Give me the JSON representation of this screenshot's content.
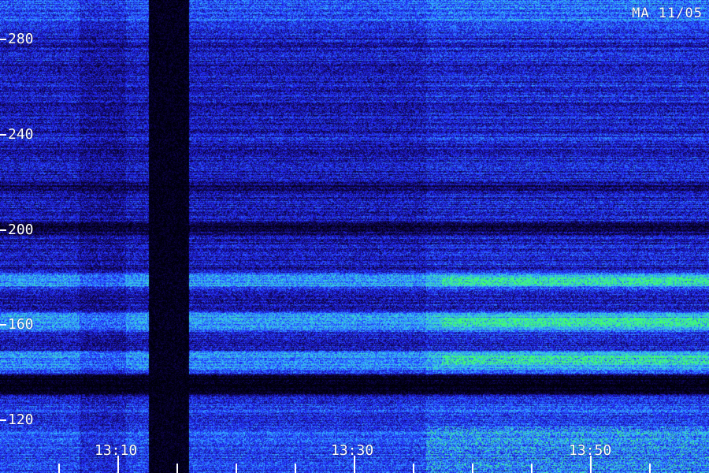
{
  "title": "MA 11/05",
  "y_axis": {
    "labels": [
      "280",
      "240",
      "200",
      "160",
      "120"
    ],
    "values": [
      280,
      240,
      200,
      160,
      120
    ],
    "range": [
      112,
      298
    ]
  },
  "x_axis": {
    "labels": [
      "13:10",
      "13:30",
      "13:50"
    ],
    "major_times_min": [
      790,
      810,
      830
    ],
    "minor_step_min": 5,
    "range_min": [
      775,
      835
    ]
  },
  "colors": {
    "background": "#000000",
    "low": "#0a0a40",
    "mid": "#1f3cff",
    "high": "#35c8ff",
    "peak": "#39ff6a",
    "axis": "#ffffff"
  }
}
